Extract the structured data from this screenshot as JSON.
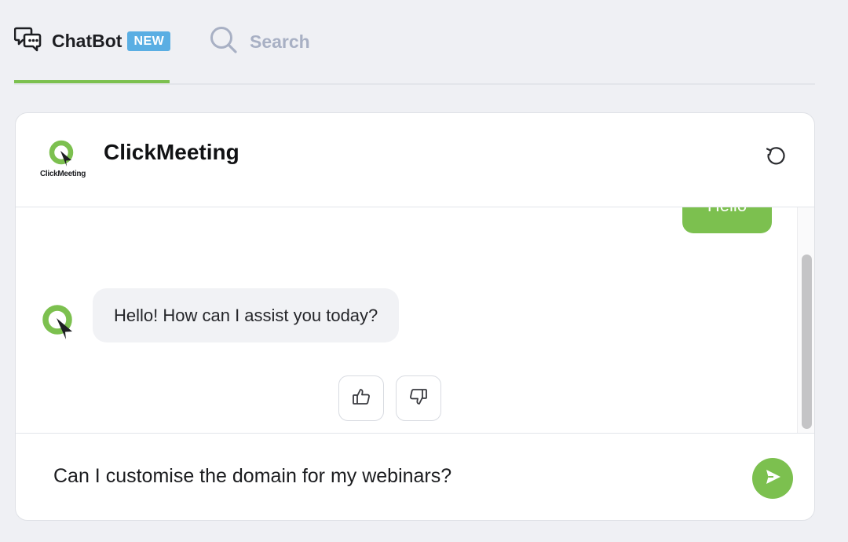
{
  "tabs": {
    "chatbot": {
      "label": "ChatBot",
      "badge": "NEW",
      "icon": "chat-bubbles-icon"
    },
    "search": {
      "label": "Search",
      "icon": "search-icon"
    }
  },
  "header": {
    "logo_text": "ClickMeeting",
    "title": "ClickMeeting",
    "reset_icon": "refresh-icon"
  },
  "messages": {
    "user_message": "Hello",
    "bot_message": "Hello! How can I assist you today?",
    "feedback": {
      "like_icon": "thumbs-up-icon",
      "dislike_icon": "thumbs-down-icon"
    }
  },
  "composer": {
    "input_value": "Can I customise the domain for my webinars?",
    "send_icon": "send-icon"
  },
  "colors": {
    "accent": "#7cc04f",
    "badge": "#5aaee3",
    "background": "#eff0f4",
    "muted": "#a8b0c4"
  }
}
